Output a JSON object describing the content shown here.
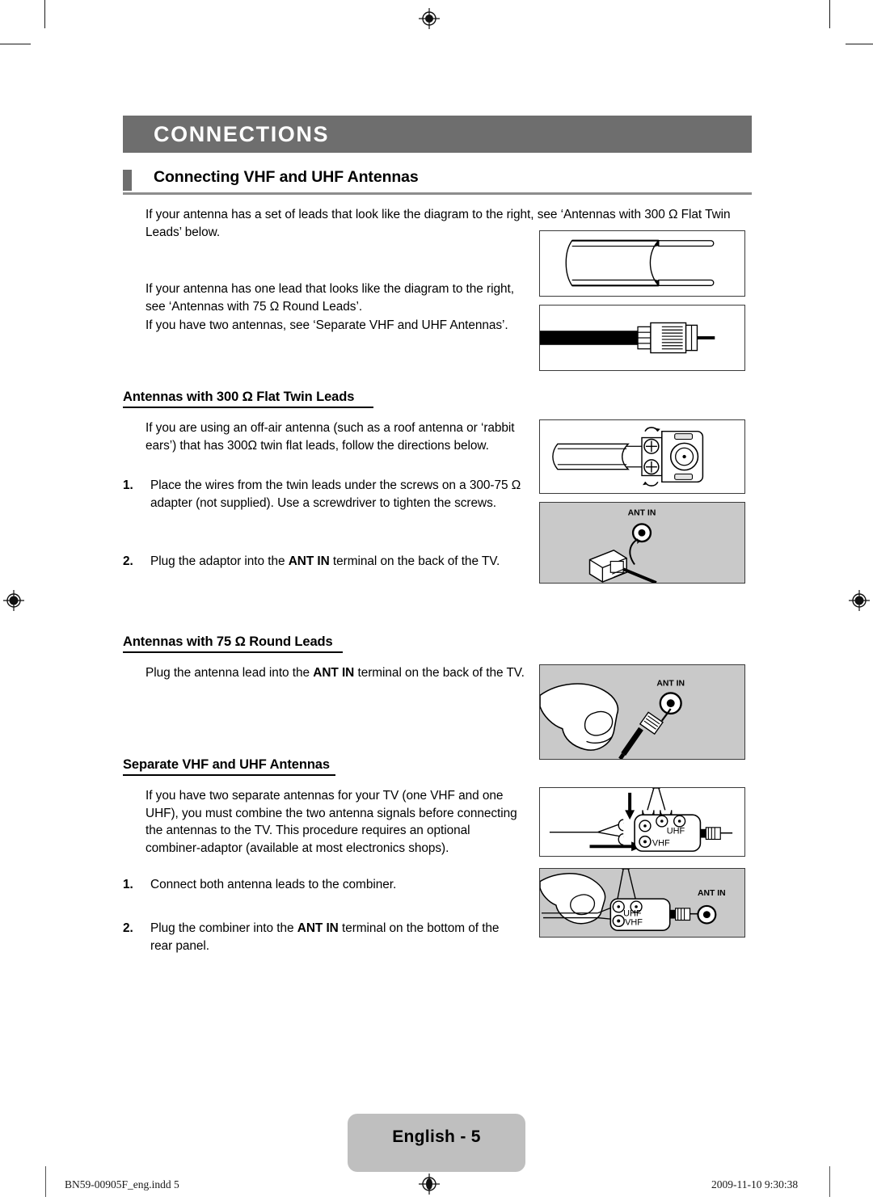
{
  "chapter": {
    "title": "CONNECTIONS"
  },
  "section": {
    "title": "Connecting VHF and UHF Antennas"
  },
  "intro": {
    "p1": "If your antenna has a set of leads that look like the diagram to the right, see ‘Antennas with 300 Ω Flat Twin Leads’ below.",
    "p2": "If your antenna has one lead that looks like the diagram to the right, see ‘Antennas with 75 Ω Round Leads’.",
    "p3": "If you have two antennas, see ‘Separate VHF and UHF Antennas’."
  },
  "flat_twin": {
    "heading": "Antennas with 300 Ω Flat Twin Leads",
    "intro": "If you are using an off-air antenna (such as a roof antenna or ‘rabbit ears’) that has 300Ω twin flat leads, follow the directions below.",
    "steps": [
      {
        "num": "1.",
        "text_pre": "Place the wires from the twin leads under the screws on a 300-75 Ω adapter (not supplied). Use a screwdriver to tighten the screws.",
        "bold": "",
        "text_post": ""
      },
      {
        "num": "2.",
        "text_pre": "Plug the adaptor into the ",
        "bold": "ANT IN",
        "text_post": " terminal on the back of the TV."
      }
    ]
  },
  "round_leads": {
    "heading": "Antennas with 75 Ω Round Leads",
    "text_pre": "Plug the antenna lead into the ",
    "bold": "ANT IN",
    "text_post": " terminal on the back of the TV."
  },
  "separate": {
    "heading": "Separate VHF and UHF Antennas",
    "intro": "If you have two separate antennas for your TV (one VHF and one UHF), you must combine the two antenna signals before connecting the antennas to the TV. This procedure requires an optional combiner-adaptor (available at most electronics shops).",
    "steps": [
      {
        "num": "1.",
        "text_pre": "Connect both antenna leads to the combiner.",
        "bold": "",
        "text_post": ""
      },
      {
        "num": "2.",
        "text_pre": "Plug the combiner into the ",
        "bold": "ANT IN",
        "text_post": " terminal on the bottom of the rear panel."
      }
    ]
  },
  "figures": {
    "flat_twin_cable_label": "",
    "round_cable_label": "",
    "adapter_label": "",
    "ant_in_label": "ANT IN",
    "uhf_label": "UHF",
    "vhf_label": "VHF"
  },
  "footer": {
    "page_label": "English - 5",
    "file_name": "BN59-00905F_eng.indd   5",
    "timestamp": "2009-11-10   9:30:38"
  },
  "colors": {
    "chapter_bar": "#6e6e6e",
    "accent_square": "#6e6e6e",
    "section_rule": "#8c8c8c",
    "figure_gray": "#c9c9c9",
    "badge_gray": "#bfbfbf"
  }
}
